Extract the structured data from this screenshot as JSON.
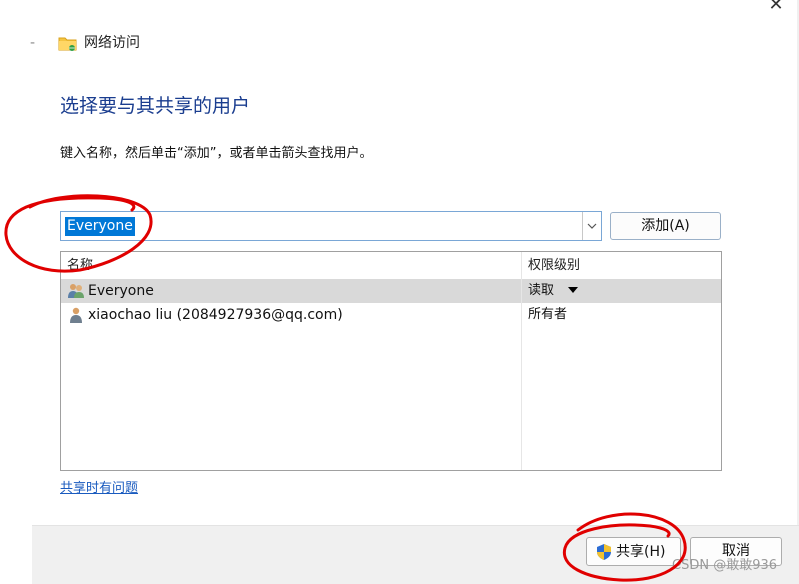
{
  "window": {
    "back": "-",
    "title": "网络访问",
    "close": "✕"
  },
  "heading": "选择要与其共享的用户",
  "instruction": "键入名称，然后单击“添加”，或者单击箭头查找用户。",
  "combo": {
    "value": "Everyone"
  },
  "add_button": "添加(A)",
  "list": {
    "columns": [
      "名称",
      "权限级别"
    ],
    "rows": [
      {
        "name": "Everyone",
        "permission": "读取",
        "icon": "group-user-icon",
        "selected": true
      },
      {
        "name": "xiaochao liu (2084927936@qq.com)",
        "permission": "所有者",
        "icon": "user-icon",
        "selected": false
      }
    ]
  },
  "help_link": "共享时有问题",
  "footer": {
    "share_button": "共享(H)",
    "cancel_button": "取消"
  },
  "watermark": "CSDN @敢敢936",
  "colors": {
    "heading": "#1a3d8f",
    "link": "#1a5bbf",
    "selection": "#0078d7",
    "annotation": "#e00000"
  }
}
